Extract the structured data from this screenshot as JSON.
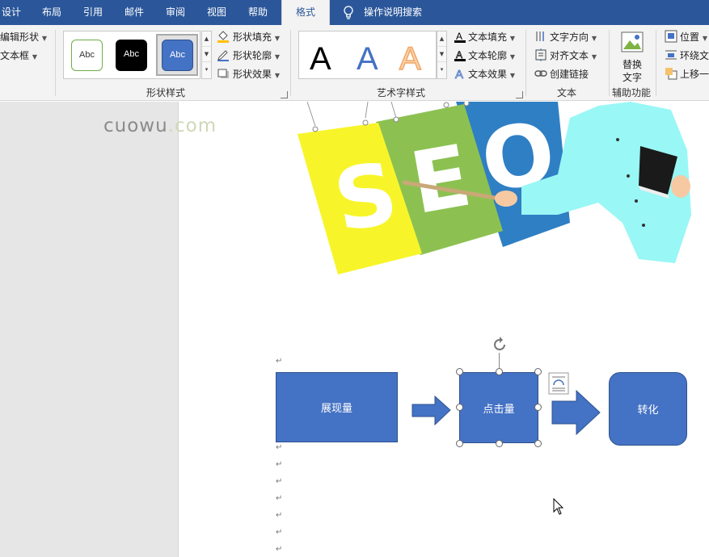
{
  "tabs": [
    {
      "label": "设计",
      "active": false
    },
    {
      "label": "布局",
      "active": false
    },
    {
      "label": "引用",
      "active": false
    },
    {
      "label": "邮件",
      "active": false
    },
    {
      "label": "审阅",
      "active": false
    },
    {
      "label": "视图",
      "active": false
    },
    {
      "label": "帮助",
      "active": false
    },
    {
      "label": "格式",
      "active": true
    }
  ],
  "tell_me": {
    "label": "操作说明搜索",
    "icon": "lightbulb-icon"
  },
  "ribbon": {
    "insert_shapes": {
      "edit_shape": "编辑形状",
      "text_box": "文本框"
    },
    "shape_styles": {
      "group_label": "形状样式",
      "thumbnails": [
        {
          "text": "Abc",
          "style": "outline-green"
        },
        {
          "text": "Abc",
          "style": "fill-black"
        },
        {
          "text": "Abc",
          "style": "fill-blue-selected"
        }
      ],
      "fill": "形状填充",
      "outline": "形状轮廓",
      "effects": "形状效果"
    },
    "wordart_styles": {
      "group_label": "艺术字样式",
      "samples": [
        "A",
        "A",
        "A"
      ],
      "text_fill": "文本填充",
      "text_outline": "文本轮廓",
      "text_effects": "文本效果"
    },
    "text": {
      "group_label": "文本",
      "direction": "文字方向",
      "align": "对齐文本",
      "link": "创建链接"
    },
    "accessibility": {
      "group_label": "辅助功能",
      "alt_text_line1": "替换",
      "alt_text_line2": "文字"
    },
    "arrange": {
      "position": "位置",
      "wrap": "环绕文",
      "bring_forward": "上移一"
    }
  },
  "watermark": {
    "part1": "cuowu",
    "part2": ".com"
  },
  "illustration": {
    "letters": [
      "S",
      "E",
      "O"
    ]
  },
  "flowchart": {
    "shapes": [
      {
        "label": "展现量",
        "selected": false
      },
      {
        "label": "点击量",
        "selected": true
      },
      {
        "label": "转化",
        "selected": false
      }
    ]
  },
  "colors": {
    "ribbon_blue": "#2b579a",
    "shape_blue": "#4472c4",
    "seo_yellow": "#f7f52a",
    "seo_green": "#8cc152",
    "seo_blue": "#2f7fc4",
    "figure_cyan": "#99f7f5"
  },
  "paragraph_mark": "↵"
}
